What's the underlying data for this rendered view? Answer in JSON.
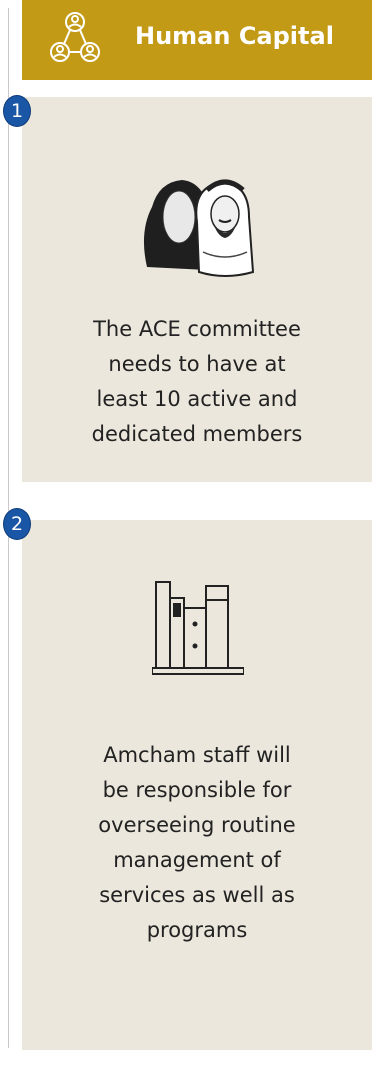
{
  "header": {
    "title": "Human Capital",
    "icon": "people-network-icon"
  },
  "cards": [
    {
      "number": "1",
      "icon": "saudi-couple-icon",
      "text": "The ACE committee\nneeds to have at\nleast 10 active and\ndedicated members"
    },
    {
      "number": "2",
      "icon": "bookshelf-icon",
      "text": "Amcham staff will\nbe  responsible for\noverseeing routine\nmanagement of\nservices as well as\nprograms"
    }
  ],
  "colors": {
    "header_bg": "#c29a16",
    "card_bg": "#ebe7dc",
    "badge": "#1a56a6"
  }
}
